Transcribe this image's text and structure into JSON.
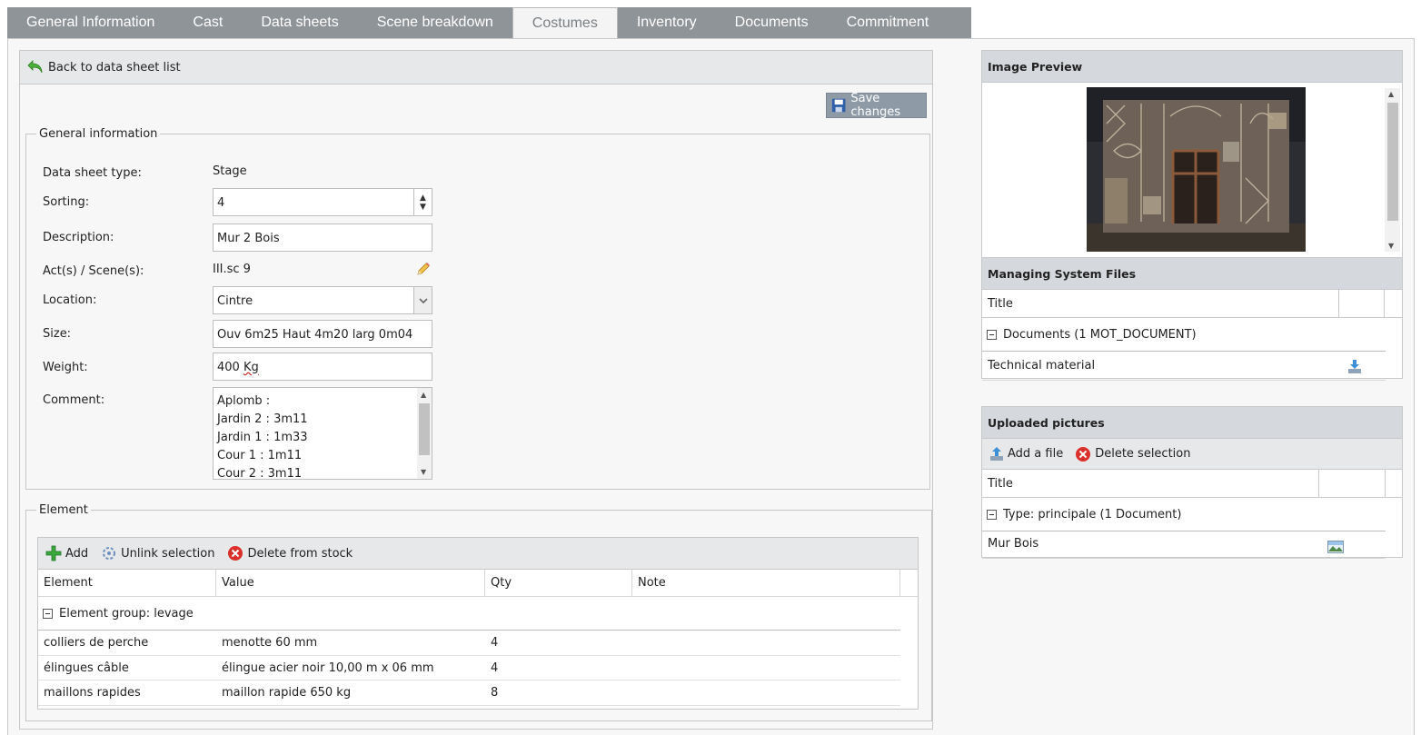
{
  "tabs": [
    {
      "label": "General Information",
      "active": false
    },
    {
      "label": "Cast",
      "active": false
    },
    {
      "label": "Data sheets",
      "active": false
    },
    {
      "label": "Scene breakdown",
      "active": false
    },
    {
      "label": "Costumes",
      "active": true
    },
    {
      "label": "Inventory",
      "active": false
    },
    {
      "label": "Documents",
      "active": false
    },
    {
      "label": "Commitment",
      "active": false
    }
  ],
  "header": {
    "back_label": "Back to data sheet list"
  },
  "save_label": "Save changes",
  "general": {
    "legend": "General information",
    "fields": {
      "type_label": "Data sheet type:",
      "type_value": "Stage",
      "sorting_label": "Sorting:",
      "sorting_value": "4",
      "description_label": "Description:",
      "description_value": "Mur 2 Bois",
      "acts_label": "Act(s) / Scene(s):",
      "acts_value": "III.sc 9",
      "location_label": "Location:",
      "location_value": "Cintre",
      "size_label": "Size:",
      "size_value": "Ouv 6m25 Haut 4m20 larg 0m04",
      "weight_label": "Weight:",
      "weight_number": "400",
      "weight_unit": "Kg",
      "comment_label": "Comment:",
      "comment_lines": [
        "Aplomb :",
        "Jardin 2 : 3m11",
        "Jardin 1 : 1m33",
        "Cour 1 : 1m11",
        "Cour 2 : 3m11"
      ]
    }
  },
  "element": {
    "legend": "Element",
    "toolbar": {
      "add": "Add",
      "unlink": "Unlink selection",
      "delete": "Delete from stock"
    },
    "columns": [
      "Element",
      "Value",
      "Qty",
      "Note"
    ],
    "group_label": "Element group: levage",
    "rows": [
      {
        "element": "colliers de perche",
        "value": "menotte 60 mm",
        "qty": "4",
        "note": ""
      },
      {
        "element": "élingues câble",
        "value": "élingue acier noir 10,00 m x 06 mm",
        "qty": "4",
        "note": ""
      },
      {
        "element": "maillons rapides",
        "value": "maillon rapide 650 kg",
        "qty": "8",
        "note": ""
      }
    ]
  },
  "image_preview": {
    "title": "Image Preview"
  },
  "system_files": {
    "title": "Managing System Files",
    "column_title": "Title",
    "group_label": "Documents (1 MOT_DOCUMENT)",
    "rows": [
      {
        "title": "Technical material"
      }
    ]
  },
  "uploaded": {
    "title": "Uploaded pictures",
    "toolbar": {
      "add": "Add a file",
      "delete": "Delete selection"
    },
    "column_title": "Title",
    "group_label": "Type: principale (1 Document)",
    "rows": [
      {
        "title": "Mur Bois"
      }
    ]
  },
  "colors": {
    "tab_bar": "#8f9499",
    "header_bg": "#d5d8dc",
    "save_button": "#8e9aa6",
    "accent_green": "#3aa83a",
    "accent_red": "#d9302a"
  }
}
